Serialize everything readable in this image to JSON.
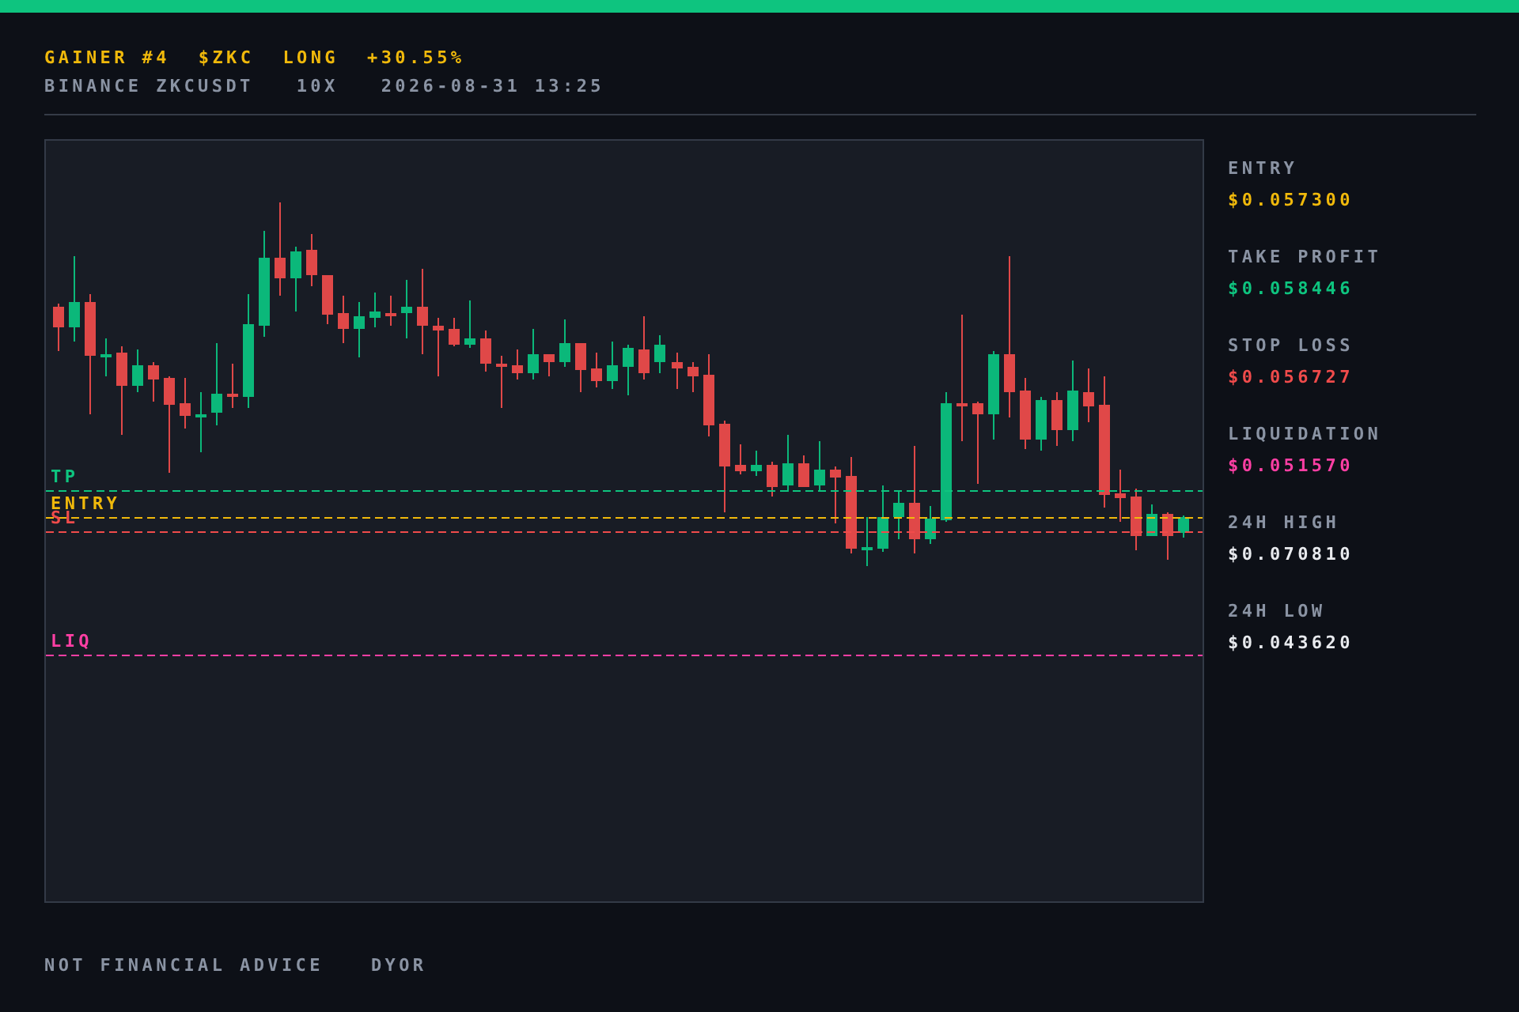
{
  "header": {
    "title_parts": [
      "GAINER #4",
      "$ZKC",
      "LONG",
      "+30.55%"
    ],
    "subtitle_parts": [
      "BINANCE ZKCUSDT",
      "10X",
      "2026-08-31 13:25"
    ]
  },
  "chart": {
    "levels": [
      {
        "kind": "tp",
        "label": "TP"
      },
      {
        "kind": "entry",
        "label": "ENTRY"
      },
      {
        "kind": "sl",
        "label": "SL"
      },
      {
        "kind": "liq",
        "label": "LIQ"
      }
    ]
  },
  "stats": [
    {
      "kind": "entry",
      "label": "ENTRY",
      "value": "$0.057300"
    },
    {
      "kind": "tp",
      "label": "TAKE PROFIT",
      "value": "$0.058446"
    },
    {
      "kind": "sl",
      "label": "STOP LOSS",
      "value": "$0.056727"
    },
    {
      "kind": "liq",
      "label": "LIQUIDATION",
      "value": "$0.051570"
    },
    {
      "kind": "high",
      "label": "24H HIGH",
      "value": "$0.070810"
    },
    {
      "kind": "low",
      "label": "24H LOW",
      "value": "$0.043620"
    }
  ],
  "footer": [
    "NOT FINANCIAL ADVICE",
    "DYOR"
  ]
}
